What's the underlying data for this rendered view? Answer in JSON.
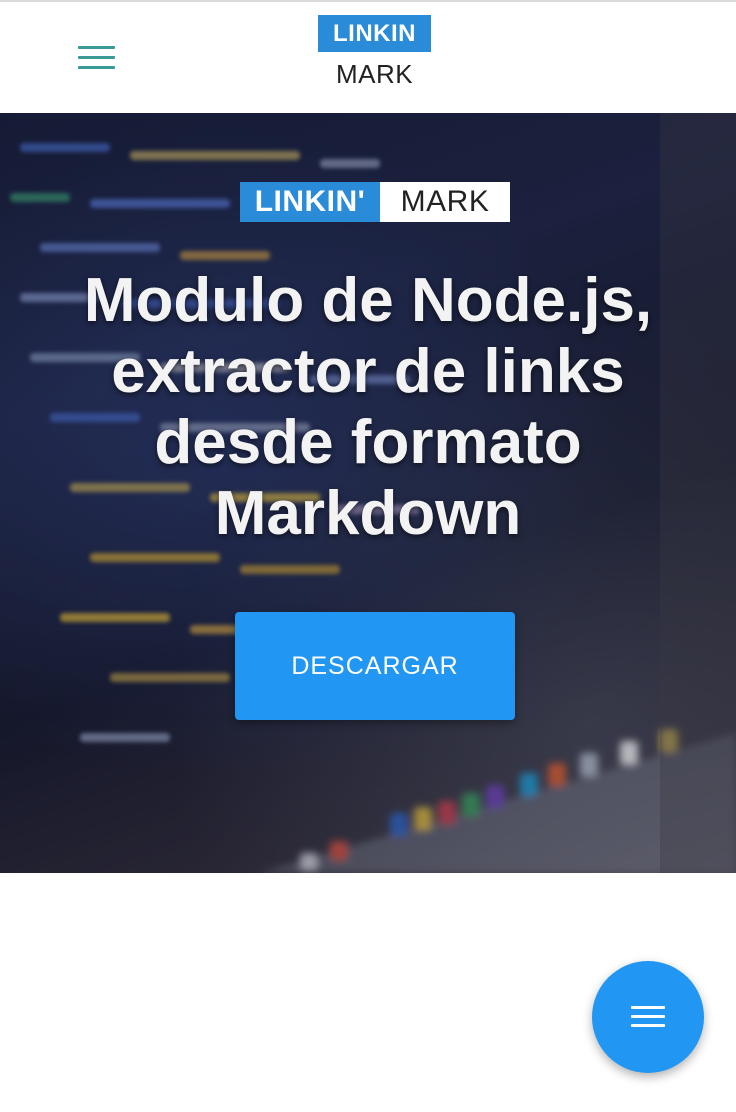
{
  "header": {
    "menu_icon": "hamburger-icon",
    "logo": {
      "top_text": "LINKIN",
      "bottom_text": "MARK",
      "color": "#2a8bd9"
    }
  },
  "hero": {
    "logo": {
      "left_text": "LINKIN'",
      "right_text": "MARK"
    },
    "title_lines": [
      "Modulo de Node.js,",
      "extractor de links",
      "desde formato",
      "Markdown"
    ],
    "button_label": "DESCARGAR",
    "button_color": "#2196f3",
    "background": "code-on-screen-photo"
  },
  "fab": {
    "icon": "menu-icon",
    "color": "#2196f3"
  }
}
